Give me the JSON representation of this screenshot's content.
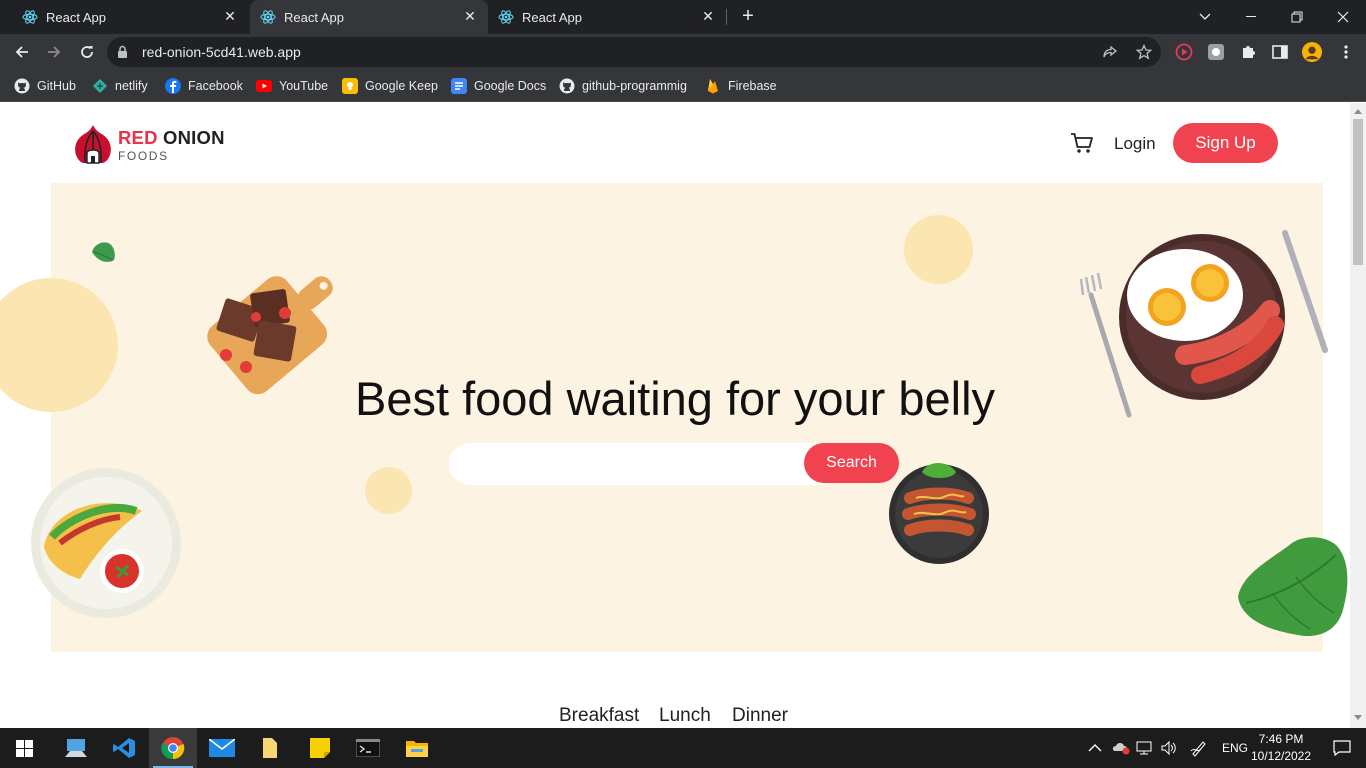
{
  "browser": {
    "tabs": [
      {
        "title": "React App",
        "active": false
      },
      {
        "title": "React App",
        "active": true
      },
      {
        "title": "React App",
        "active": false
      }
    ],
    "url": "red-onion-5cd41.web.app",
    "bookmarks": [
      {
        "label": "GitHub",
        "icon": "github-icon",
        "color": "#ffffff"
      },
      {
        "label": "netlify",
        "icon": "netlify-icon",
        "color": "#2bb3a6"
      },
      {
        "label": "Facebook",
        "icon": "facebook-icon",
        "color": "#1877f2"
      },
      {
        "label": "YouTube",
        "icon": "youtube-icon",
        "color": "#ff0000"
      },
      {
        "label": "Google Keep",
        "icon": "google-keep-icon",
        "color": "#fbbc04"
      },
      {
        "label": "Google Docs",
        "icon": "google-docs-icon",
        "color": "#4285f4"
      },
      {
        "label": "github-programmig",
        "icon": "github-icon",
        "color": "#ffffff"
      },
      {
        "label": "Firebase",
        "icon": "firebase-icon",
        "color": "#ffa000"
      }
    ]
  },
  "site": {
    "logo": {
      "word1": "RED",
      "word2": "ONION",
      "sub": "FOODS"
    },
    "nav": {
      "login": "Login",
      "signup": "Sign Up"
    },
    "hero": {
      "headline": "Best food waiting for your belly",
      "search_placeholder": "",
      "search_button": "Search"
    },
    "food_tabs": [
      "Breakfast",
      "Lunch",
      "Dinner"
    ],
    "colors": {
      "accent": "#f0434f",
      "hero_bg": "#fdf3e3",
      "circle": "#fbe6b1"
    }
  },
  "taskbar": {
    "apps": [
      "windows-start-icon",
      "file-explorer-pc-icon",
      "vscode-icon",
      "chrome-icon",
      "mail-icon",
      "file-icon",
      "sticky-notes-icon",
      "terminal-icon",
      "folder-icon"
    ],
    "language": "ENG",
    "time": "7:46 PM",
    "date": "10/12/2022"
  }
}
